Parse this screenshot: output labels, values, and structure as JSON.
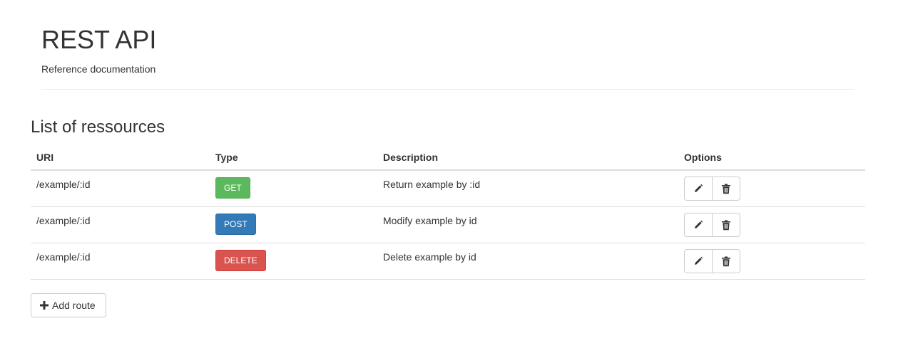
{
  "header": {
    "title": "REST API",
    "subtitle": "Reference documentation"
  },
  "section": {
    "title": "List of ressources"
  },
  "table": {
    "columns": {
      "uri": "URI",
      "type": "Type",
      "description": "Description",
      "options": "Options"
    },
    "rows": [
      {
        "uri": "/example/:id",
        "method": "GET",
        "method_color": "#5cb85c",
        "description": "Return example by :id"
      },
      {
        "uri": "/example/:id",
        "method": "POST",
        "method_color": "#337ab7",
        "description": "Modify example by id"
      },
      {
        "uri": "/example/:id",
        "method": "DELETE",
        "method_color": "#d9534f",
        "description": "Delete example by id"
      }
    ]
  },
  "icons": {
    "edit": "pencil-icon",
    "delete": "trash-icon",
    "add": "plus-icon"
  },
  "actions": {
    "add_route_label": "Add route"
  }
}
